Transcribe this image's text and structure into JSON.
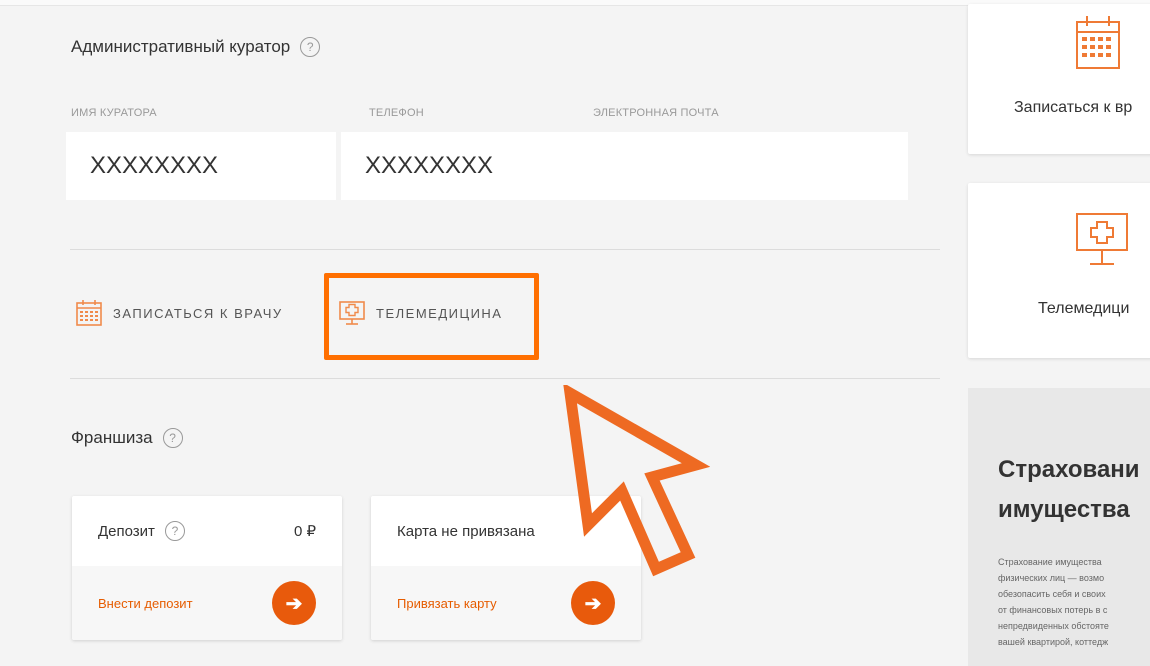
{
  "curator": {
    "title": "Административный куратор",
    "help_glyph": "?",
    "fields": [
      {
        "label": "ИМЯ КУРАТОРА",
        "value": "XXXXXXXX"
      },
      {
        "label": "ТЕЛЕФОН",
        "value": "XXXXXXXX"
      },
      {
        "label": "ЭЛЕКТРОННАЯ ПОЧТА",
        "value": ""
      }
    ]
  },
  "actions": {
    "appointment_label": "ЗАПИСАТЬСЯ К ВРАЧУ",
    "telemedicine_label": "ТЕЛЕМЕДИЦИНА"
  },
  "franchise": {
    "title": "Франшиза",
    "help_glyph": "?",
    "deposit": {
      "title": "Депозит",
      "amount": "0 ₽",
      "action": "Внести депозит",
      "arrow": "➔"
    },
    "card": {
      "title": "Карта не привязана",
      "action": "Привязать карту",
      "arrow": "➔"
    }
  },
  "sidebar": {
    "appointment": "Записаться к вр",
    "telemedicine": "Телемедици",
    "promo_title_lines": [
      "Страховани",
      "имущества"
    ],
    "promo_text_lines": [
      "Страхование имущества",
      "физических лиц — возмо",
      "обезопасить себя и своих",
      "от финансовых потерь в с",
      "непредвиденных обстояте",
      "вашей квартирой, коттедж"
    ]
  },
  "colors": {
    "accent": "#ff6f00",
    "button": "#e85a0c",
    "link": "#e65c00"
  }
}
